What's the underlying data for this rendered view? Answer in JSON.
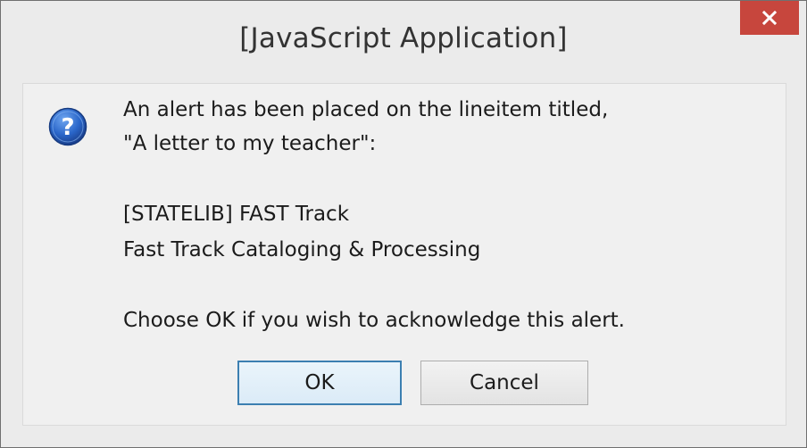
{
  "window": {
    "title": "[JavaScript Application]",
    "close_label": "×"
  },
  "message": {
    "icon": "question-icon",
    "lines": [
      "An alert has been placed on the lineitem titled,",
      "\"A letter to my teacher\":",
      "[STATELIB] FAST Track",
      "Fast Track Cataloging & Processing",
      "Choose OK if you wish to acknowledge this alert."
    ]
  },
  "buttons": {
    "ok_label": "OK",
    "cancel_label": "Cancel"
  },
  "colors": {
    "close_button": "#c7463d",
    "accent_border": "#3c7fb1",
    "icon_blue": "#2a66c9"
  }
}
